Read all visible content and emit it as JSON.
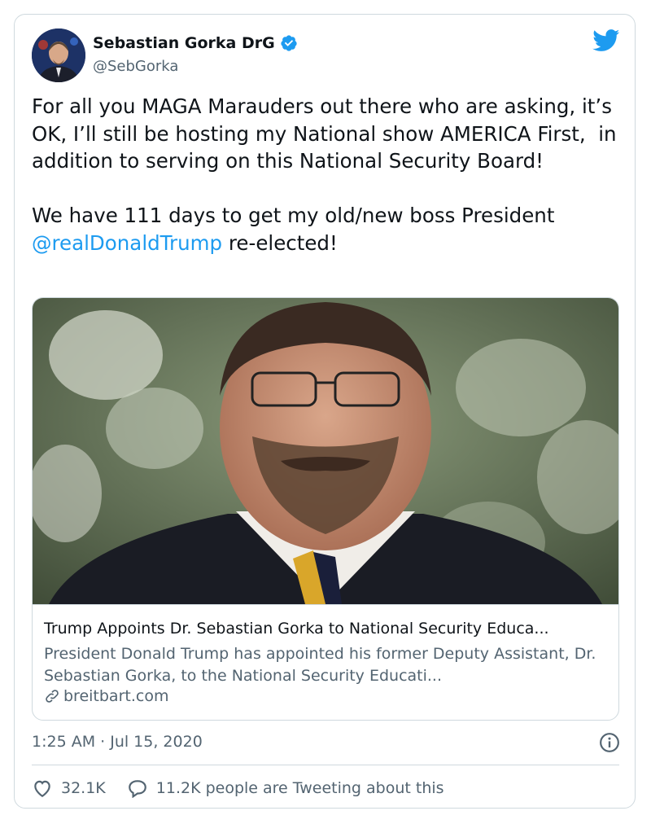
{
  "tweet": {
    "author_name": "Sebastian Gorka DrG",
    "handle": "@SebGorka",
    "text_part1": "For all you MAGA Marauders out there who are asking, it’s OK, I’ll still be hosting my National show AMERICA First,  in addition to serving on this National Security Board!\n\nWe have 111 days to get my old/new boss President ",
    "mention": "@realDonaldTrump",
    "text_part2": " re-elected!",
    "timestamp": "1:25 AM · Jul 15, 2020"
  },
  "link_card": {
    "title": "Trump Appoints Dr. Sebastian Gorka to National Security Educa...",
    "description": "President Donald Trump has appointed his former Deputy Assistant, Dr. Sebastian Gorka, to the National Security Educati...",
    "domain": "breitbart.com"
  },
  "actions": {
    "likes": "32.1K",
    "conversation": "11.2K people are Tweeting about this"
  },
  "icons": {
    "verified": "verified-badge-icon",
    "platform": "twitter-bird-icon",
    "info": "info-icon",
    "like": "heart-icon",
    "reply": "speech-bubble-icon",
    "link": "link-icon"
  },
  "colors": {
    "accent": "#1d9bf0",
    "text": "#0f1419",
    "secondary": "#536471",
    "border": "#cfd9de"
  }
}
